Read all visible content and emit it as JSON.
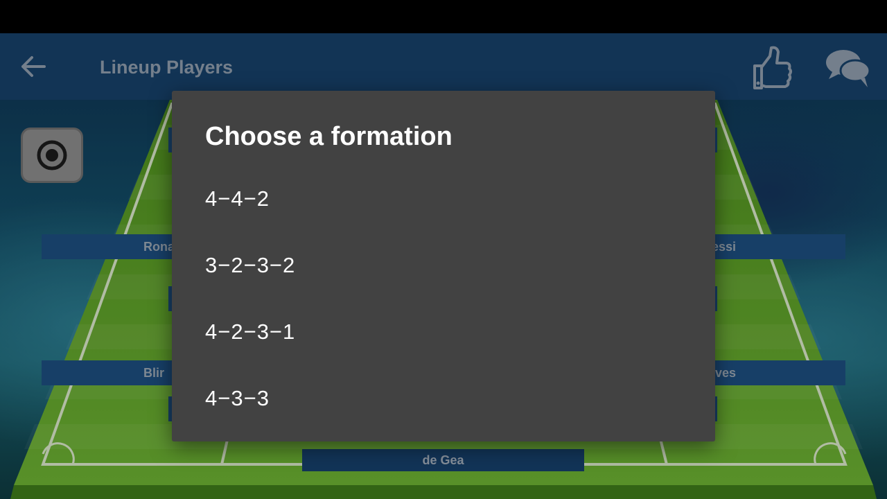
{
  "app_bar": {
    "title": "Lineup Players",
    "back_icon": "arrow-left-icon",
    "like_icon": "thumbs-up-icon",
    "chat_icon": "chat-bubbles-icon"
  },
  "camera_button": {
    "icon": "camera-shutter-icon"
  },
  "players": {
    "left_forward": "Ronal",
    "right_forward": "essi",
    "left_mid": "Blir",
    "right_mid": "ves",
    "goalkeeper": "de Gea"
  },
  "dialog": {
    "title": "Choose a formation",
    "options": [
      {
        "label": "4−4−2"
      },
      {
        "label": "3−2−3−2"
      },
      {
        "label": "4−2−3−1"
      },
      {
        "label": "4−3−3"
      }
    ]
  },
  "colors": {
    "app_bar": "#164068",
    "dialog_bg": "#424242",
    "pitch_green": "#5a9e2a",
    "label_bg": "#1d4d7e"
  }
}
